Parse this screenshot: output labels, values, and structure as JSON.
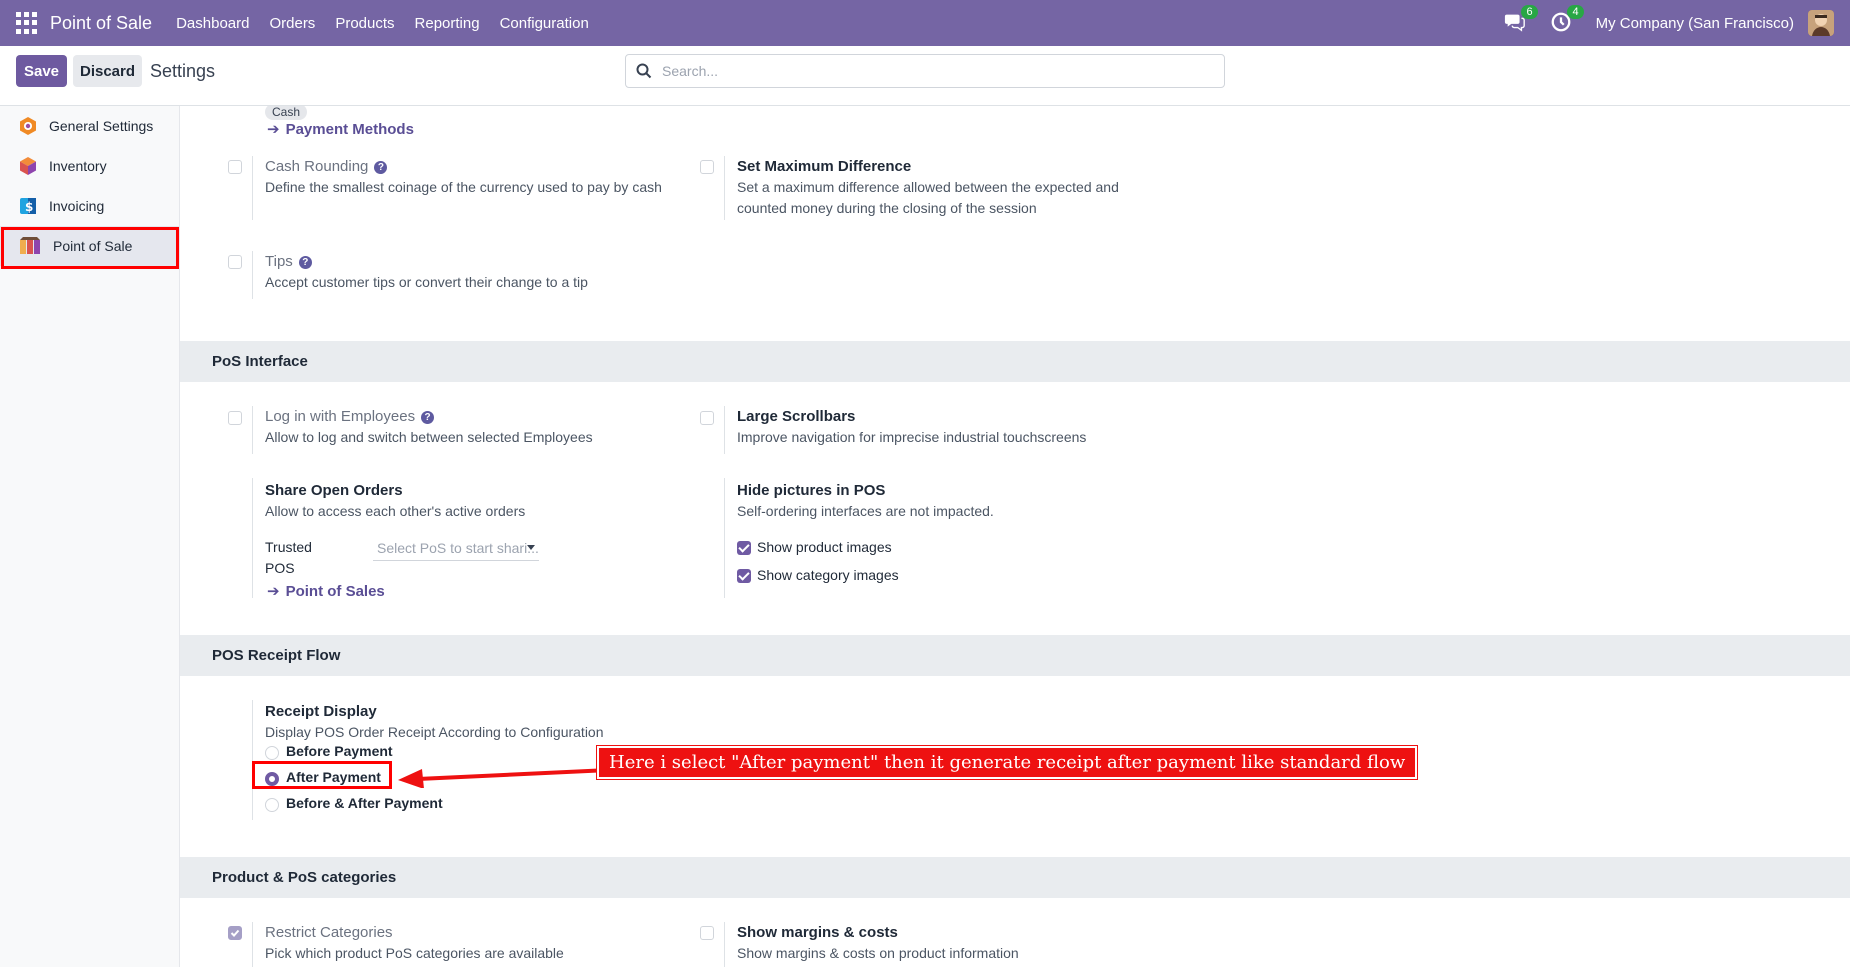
{
  "navbar": {
    "app_title": "Point of Sale",
    "menu": [
      "Dashboard",
      "Orders",
      "Products",
      "Reporting",
      "Configuration"
    ],
    "messages_count": "6",
    "activities_count": "4",
    "company": "My Company (San Francisco)"
  },
  "control_panel": {
    "save_label": "Save",
    "discard_label": "Discard",
    "title": "Settings",
    "search_placeholder": "Search..."
  },
  "sidebar": {
    "items": [
      {
        "label": "General Settings",
        "icon": "odoo-logo-icon"
      },
      {
        "label": "Inventory",
        "icon": "inventory-cube-icon"
      },
      {
        "label": "Invoicing",
        "icon": "invoicing-dollar-icon"
      },
      {
        "label": "Point of Sale",
        "icon": "pos-shop-icon",
        "active": true
      }
    ]
  },
  "payment": {
    "cash_tag": "Cash",
    "payment_methods_link": "Payment Methods",
    "cash_rounding": {
      "title": "Cash Rounding",
      "desc": "Define the smallest coinage of the currency used to pay by cash",
      "checked": false
    },
    "max_difference": {
      "title": "Set Maximum Difference",
      "desc_line1": "Set a maximum difference allowed between the expected and",
      "desc_line2": "counted money during the closing of the session",
      "checked": false
    },
    "tips": {
      "title": "Tips",
      "desc": "Accept customer tips or convert their change to a tip",
      "checked": false
    }
  },
  "pos_interface": {
    "heading": "PoS Interface",
    "login_employees": {
      "title": "Log in with Employees",
      "desc": "Allow to log and switch between selected Employees",
      "checked": false
    },
    "large_scrollbars": {
      "title": "Large Scrollbars",
      "desc": "Improve navigation for imprecise industrial touchscreens",
      "checked": false
    },
    "share_orders": {
      "title": "Share Open Orders",
      "desc": "Allow to access each other's active orders",
      "trusted_label_1": "Trusted",
      "trusted_label_2": "POS",
      "select_placeholder": "Select PoS to start shari...",
      "link": "Point of Sales"
    },
    "hide_pictures": {
      "title": "Hide pictures in POS",
      "desc": "Self-ordering interfaces are not impacted.",
      "option1": "Show product images",
      "option2": "Show category images"
    }
  },
  "receipt_flow": {
    "heading": "POS Receipt Flow",
    "title": "Receipt Display",
    "desc": "Display POS Order Receipt According to Configuration",
    "options": [
      "Before Payment",
      "After Payment",
      "Before & After Payment"
    ],
    "selected": "After Payment",
    "annotation": "Here i select \"After payment\" then it generate receipt after payment like standard flow"
  },
  "categories": {
    "heading": "Product & PoS categories",
    "restrict": {
      "title": "Restrict Categories",
      "desc": "Pick which product PoS categories are available",
      "checked": true
    },
    "margins": {
      "title": "Show margins & costs",
      "desc": "Show margins & costs on product information",
      "checked": false
    }
  },
  "colors": {
    "navbar": "#7565a4",
    "accent": "#6f5aa3",
    "annotation": "#ee1111"
  }
}
